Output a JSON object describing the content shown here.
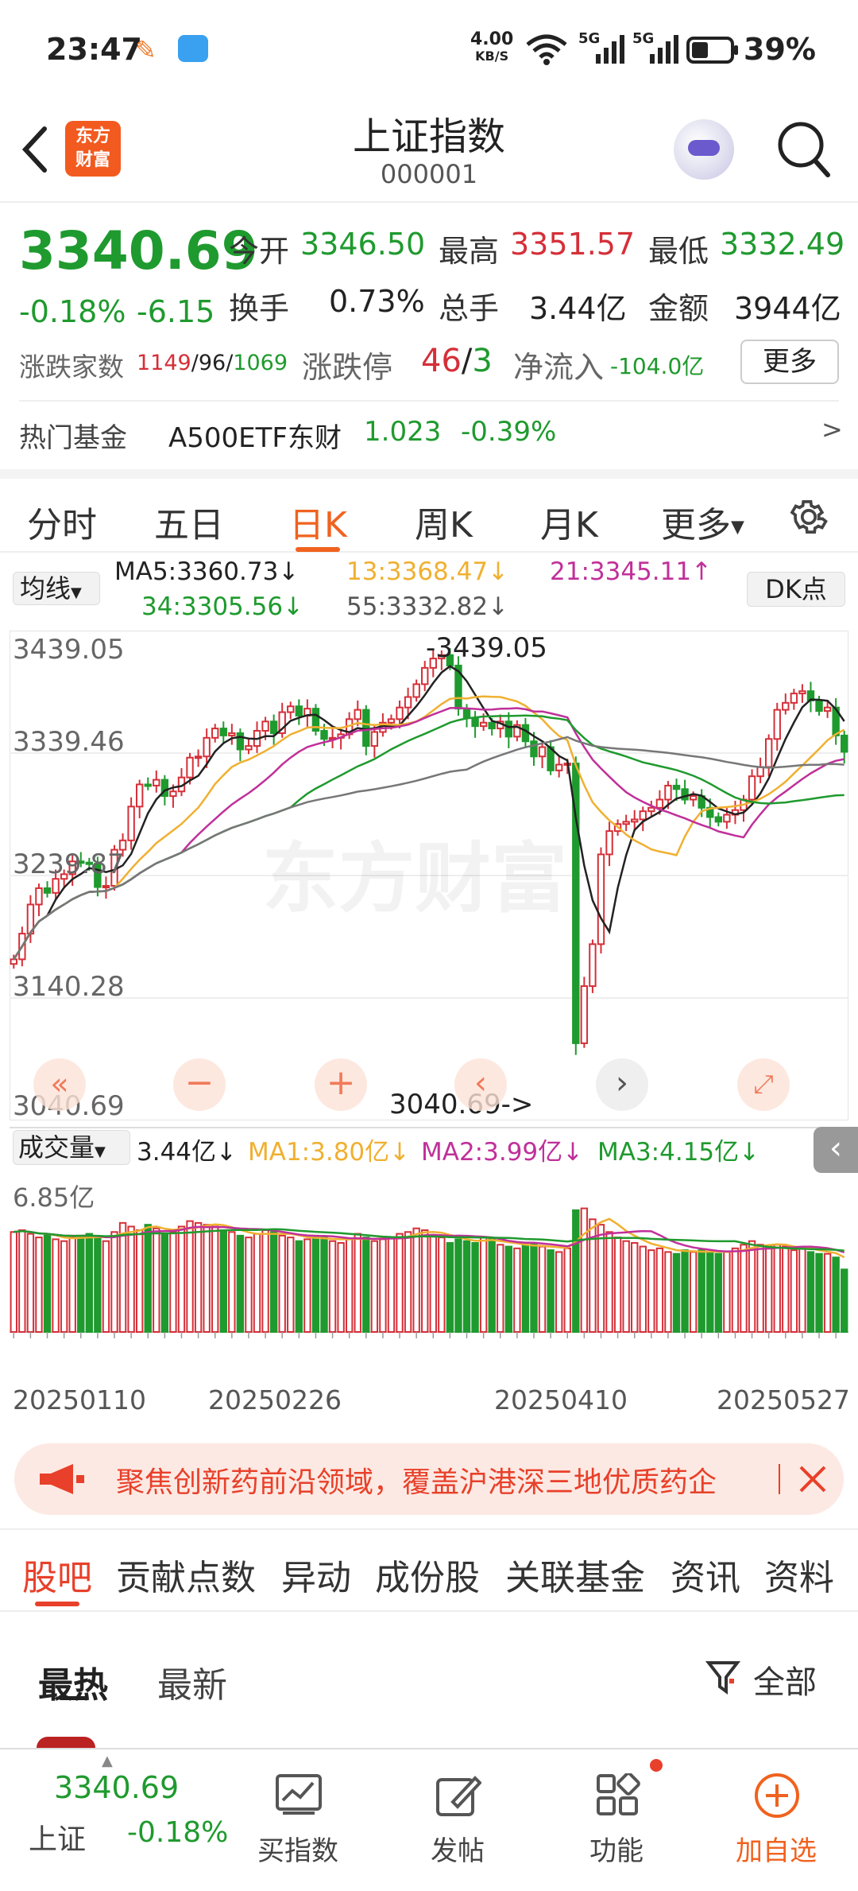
{
  "status": {
    "time": "23:47",
    "net_speed": "4.00",
    "net_unit": "KB/S",
    "signal1": "5G",
    "signal2": "5G",
    "battery": "39%"
  },
  "nav": {
    "title": "上证指数",
    "code": "000001",
    "logo_line1": "东方",
    "logo_line2": "财富"
  },
  "quote": {
    "price": "3340.69",
    "change_pct": "-0.18%",
    "change": "-6.15",
    "open_label": "今开",
    "open": "3346.50",
    "high_label": "最高",
    "high": "3351.57",
    "low_label": "最低",
    "low": "3332.49",
    "turnover_label": "换手",
    "turnover": "0.73%",
    "volume_label": "总手",
    "volume": "3.44亿",
    "amount_label": "金额",
    "amount": "3944亿",
    "breadth_label": "涨跌家数",
    "breadth_up": "1149",
    "breadth_flat": "96",
    "breadth_down": "1069",
    "limit_label": "涨跌停",
    "limit_up": "46",
    "limit_down": "3",
    "netflow_label": "净流入",
    "netflow": "-104.0亿",
    "more_button": "更多",
    "fund_label": "热门基金",
    "fund_name": "A500ETF东财",
    "fund_price": "1.023",
    "fund_change": "-0.39%",
    "fund_arrow": ">"
  },
  "tabs": [
    "分时",
    "五日",
    "日K",
    "周K",
    "月K",
    "更多"
  ],
  "active_tab": "日K",
  "indicator": {
    "ma_select": "均线",
    "ma5": "MA5:3360.73↓",
    "ma13": "13:3368.47↓",
    "ma21": "21:3345.11↑",
    "ma34": "34:3305.56↓",
    "ma55": "55:3332.82↓",
    "dk_button": "DK点",
    "vol_select": "成交量",
    "vol": "3.44亿↓",
    "vol_ma1": "MA1:3.80亿↓",
    "vol_ma2": "MA2:3.99亿↓",
    "vol_ma3": "MA3:4.15亿↓"
  },
  "chart_data": {
    "type": "candlestick",
    "y_ticks": [
      "3439.05",
      "3339.46",
      "3239.87",
      "3140.28",
      "3040.69"
    ],
    "high_label": "-3439.05",
    "low_label": "3040.69->",
    "vol_max_label": "6.85亿",
    "x_labels": [
      "20250110",
      "20250226",
      "20250410",
      "20250527"
    ],
    "watermark": "东方财富",
    "ylim": [
      3040.69,
      3439.05
    ],
    "closes": [
      3168,
      3190,
      3215,
      3229,
      3225,
      3237,
      3241,
      3252,
      3251,
      3250,
      3230,
      3231,
      3262,
      3270,
      3299,
      3318,
      3317,
      3322,
      3308,
      3312,
      3324,
      3341,
      3342,
      3358,
      3366,
      3360,
      3362,
      3348,
      3351,
      3364,
      3372,
      3362,
      3380,
      3385,
      3377,
      3383,
      3364,
      3357,
      3358,
      3361,
      3374,
      3382,
      3351,
      3363,
      3371,
      3374,
      3384,
      3393,
      3404,
      3418,
      3426,
      3429,
      3420,
      3383,
      3375,
      3368,
      3371,
      3366,
      3372,
      3359,
      3369,
      3355,
      3342,
      3350,
      3330,
      3335,
      3336,
      3096,
      3145,
      3181,
      3258,
      3278,
      3284,
      3286,
      3288,
      3295,
      3298,
      3305,
      3317,
      3314,
      3305,
      3308,
      3298,
      3290,
      3286,
      3292,
      3296,
      3305,
      3325,
      3333,
      3357,
      3382,
      3388,
      3396,
      3398,
      3390,
      3381,
      3384,
      3360,
      3346
    ],
    "volumes": [
      5.5,
      5.6,
      5.4,
      5.2,
      5.3,
      5.1,
      5.0,
      5.2,
      5.3,
      5.4,
      5.2,
      5.0,
      5.5,
      6.0,
      5.8,
      5.6,
      5.9,
      5.7,
      5.4,
      5.5,
      5.8,
      6.1,
      6.0,
      5.9,
      5.8,
      5.6,
      5.5,
      5.3,
      5.2,
      5.4,
      5.6,
      5.5,
      5.3,
      5.2,
      5.0,
      5.1,
      5.3,
      5.2,
      5.0,
      4.9,
      5.1,
      5.4,
      5.2,
      5.0,
      5.1,
      5.2,
      5.4,
      5.5,
      5.7,
      5.6,
      5.3,
      5.2,
      4.9,
      5.1,
      5.0,
      4.9,
      5.2,
      5.1,
      4.8,
      4.7,
      4.6,
      4.8,
      4.9,
      4.7,
      4.5,
      4.4,
      4.6,
      6.7,
      6.8,
      6.2,
      5.9,
      5.5,
      5.2,
      5.0,
      4.9,
      4.7,
      4.5,
      4.6,
      4.4,
      4.3,
      4.5,
      4.4,
      4.5,
      4.4,
      4.3,
      4.4,
      4.6,
      4.8,
      5.0,
      4.8,
      4.7,
      4.8,
      4.7,
      4.5,
      4.6,
      4.4,
      4.3,
      4.3,
      4.1,
      3.44
    ]
  },
  "banner": {
    "text": "聚焦创新药前沿领域，覆盖沪港深三地优质药企"
  },
  "subtabs": [
    "股吧",
    "贡献点数",
    "异动",
    "成份股",
    "关联基金",
    "资讯",
    "资料"
  ],
  "feed": {
    "hot": "最热",
    "new": "最新",
    "filter": "全部"
  },
  "bottom": {
    "price": "3340.69",
    "name": "上证",
    "pct": "-0.18%",
    "buy": "买指数",
    "post": "发帖",
    "func": "功能",
    "add": "加自选"
  }
}
